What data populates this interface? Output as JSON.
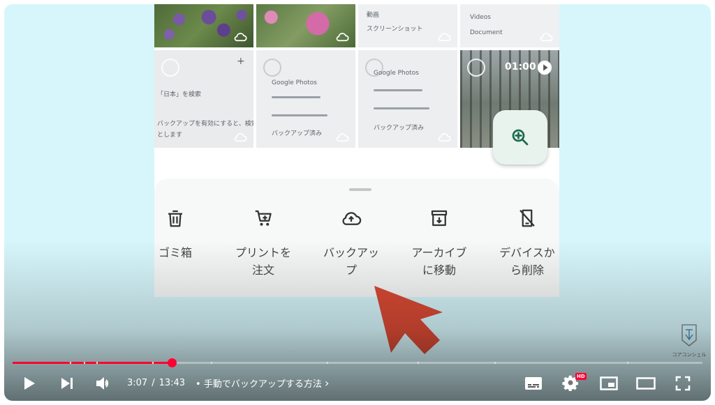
{
  "player": {
    "current_time": "3:07",
    "duration": "13:43",
    "time_separator": "/",
    "chapter_prefix": "•",
    "chapter_title": "手動でバックアップする方法",
    "chapter_arrow": "›",
    "played_fraction": 0.231,
    "hd_badge": "HD",
    "accent_color": "#ff0033"
  },
  "channel": {
    "name": "コアコンシェル"
  },
  "video_frame": {
    "thumbnails": [
      {
        "kind": "photo"
      },
      {
        "kind": "photo"
      },
      {
        "kind": "screenshot",
        "lines": [
          "動画",
          "スクリーンショット"
        ]
      },
      {
        "kind": "screenshot",
        "lines": [
          "Videos",
          "Document"
        ]
      },
      {
        "kind": "screenshot",
        "lines": [
          "「日本」を検索",
          "バックアップを有効にすると、検索の効",
          "とします"
        ]
      },
      {
        "kind": "screenshot",
        "lines": [
          "Google Photos",
          "バックアップ済み"
        ]
      },
      {
        "kind": "screenshot",
        "lines": [
          "Google Photos",
          "バックアップ済み"
        ]
      },
      {
        "kind": "video",
        "duration": "01:00"
      }
    ],
    "sheet_actions": [
      {
        "label": "ゴミ箱",
        "icon": "trash-icon"
      },
      {
        "label": "プリントを\n注文",
        "icon": "cart-icon"
      },
      {
        "label": "バックアッ\nプ",
        "icon": "cloud-upload-icon"
      },
      {
        "label": "アーカイブ\nに移動",
        "icon": "archive-icon"
      },
      {
        "label": "デバイスか\nら削除",
        "icon": "phone-remove-icon"
      }
    ],
    "fab_icon": "zoom-in-icon",
    "plus_sign": "+"
  }
}
